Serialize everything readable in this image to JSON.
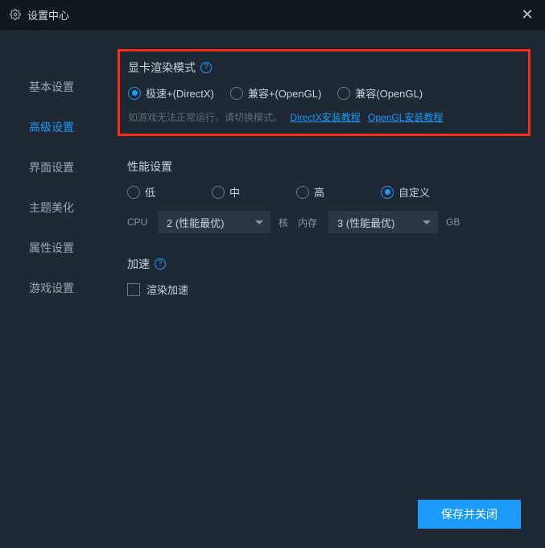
{
  "titlebar": {
    "title": "设置中心"
  },
  "sidebar": {
    "items": [
      {
        "label": "基本设置"
      },
      {
        "label": "高级设置"
      },
      {
        "label": "界面设置"
      },
      {
        "label": "主题美化"
      },
      {
        "label": "属性设置"
      },
      {
        "label": "游戏设置"
      }
    ],
    "active_index": 1
  },
  "render_mode": {
    "title": "显卡渲染模式",
    "options": [
      {
        "label": "极速+(DirectX)",
        "checked": true
      },
      {
        "label": "兼容+(OpenGL)",
        "checked": false
      },
      {
        "label": "兼容(OpenGL)",
        "checked": false
      }
    ],
    "hint_text": "如游戏无法正常运行，请切换模式。",
    "link_directx": "DirectX安装教程",
    "link_opengl": "OpenGL安装教程"
  },
  "performance": {
    "title": "性能设置",
    "options": [
      {
        "label": "低",
        "checked": false
      },
      {
        "label": "中",
        "checked": false
      },
      {
        "label": "高",
        "checked": false
      },
      {
        "label": "自定义",
        "checked": true
      }
    ],
    "cpu_label": "CPU",
    "cpu_value": "2 (性能最优)",
    "cores_label": "核",
    "mem_label": "内存",
    "mem_value": "3 (性能最优)",
    "gb_label": "GB"
  },
  "accel": {
    "title": "加速",
    "render_accel_label": "渲染加速",
    "render_accel_checked": false
  },
  "footer": {
    "save_label": "保存并关闭"
  }
}
